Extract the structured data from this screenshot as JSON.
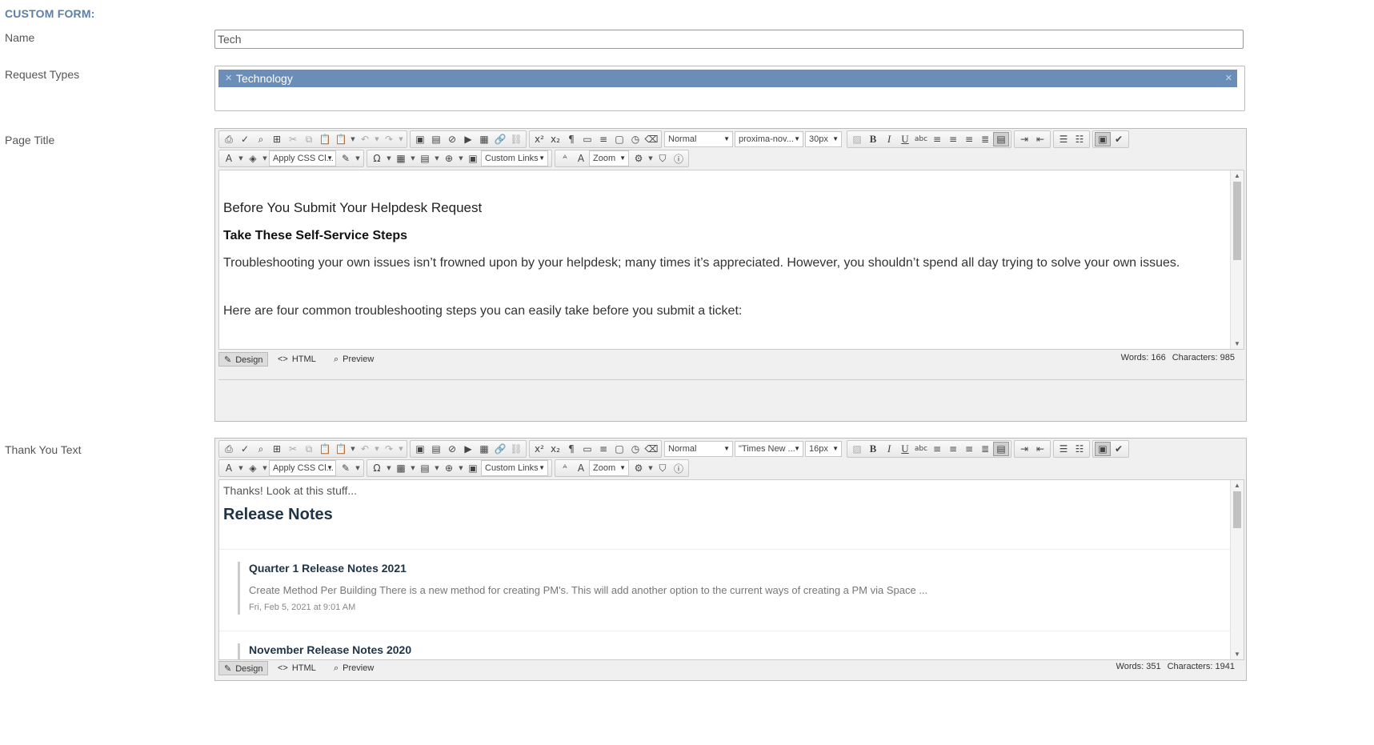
{
  "form": {
    "header": "CUSTOM FORM:",
    "name_label": "Name",
    "name_value": "Tech",
    "request_types_label": "Request Types",
    "request_type_tag": "Technology",
    "page_title_label": "Page Title",
    "thank_you_label": "Thank You Text"
  },
  "toolbar": {
    "format_block": "Normal",
    "apply_css": "Apply CSS Cl...",
    "custom_links": "Custom Links",
    "zoom": "Zoom",
    "design_label": "Design",
    "html_label": "HTML",
    "preview_label": "Preview"
  },
  "editor1": {
    "font_name": "proxima-nov...",
    "font_size": "30px",
    "heading": "Before You Submit Your Helpdesk Request",
    "subheading": "Take These Self-Service Steps",
    "paragraph1": "Troubleshooting your own issues isn’t frowned upon by your helpdesk; many times it’s appreciated. However, you shouldn’t spend all day trying to solve your own issues.",
    "paragraph2": "Here are four common troubleshooting steps you can easily take before you submit a ticket:",
    "words": "Words: 166",
    "characters": "Characters: 985"
  },
  "editor2": {
    "font_name": "\"Times New ...",
    "font_size": "16px",
    "intro": "Thanks!  Look at this stuff...",
    "heading": "Release Notes",
    "notes": [
      {
        "title": "Quarter 1 Release Notes 2021",
        "desc": "Create Method Per Building There is a new method for creating PM's. This will add another option to the current ways of creating a PM via Space ...",
        "date": "Fri, Feb 5, 2021 at 9:01 AM"
      },
      {
        "title": "November Release Notes 2020"
      }
    ],
    "words": "Words: 351",
    "characters": "Characters: 1941"
  },
  "colors": {
    "header": "#5b7fa6",
    "tag_bg": "#6a8eb8",
    "heading_dark": "#1f3347"
  }
}
